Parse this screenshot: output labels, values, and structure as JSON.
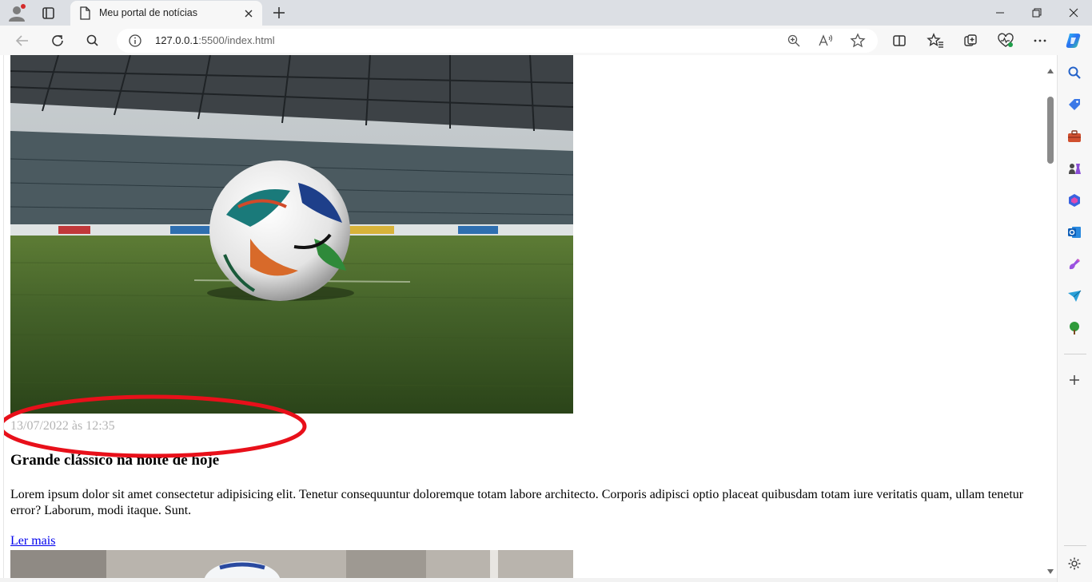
{
  "browser": {
    "tab_title": "Meu portal de notícias",
    "url_host": "127.0.0.1",
    "url_rest": ":5500/index.html",
    "icons": {
      "profile": "profile-avatar-icon",
      "tab_actions": "tab-actions-icon",
      "page": "page-icon",
      "close_tab": "close-icon",
      "new_tab": "plus-icon",
      "back": "arrow-left-icon",
      "refresh": "refresh-icon",
      "search": "search-icon",
      "site_info": "info-icon",
      "zoom": "zoom-in-icon",
      "read_aloud": "read-aloud-icon",
      "favorite": "star-icon",
      "split_screen": "split-screen-icon",
      "favorites": "favorites-icon",
      "collections": "collections-icon",
      "browser_essentials": "heart-pulse-icon",
      "more": "more-icon",
      "copilot": "copilot-icon"
    }
  },
  "sidebar": {
    "items": [
      "search-icon",
      "tag-icon",
      "toolbox-icon",
      "chess-icon",
      "microsoft365-icon",
      "outlook-icon",
      "designer-icon",
      "send-icon",
      "tree-icon",
      "plus-icon",
      "gear-icon"
    ]
  },
  "article": {
    "date": "13/07/2022 às 12:35",
    "headline": "Grande clássico na noite de hoje",
    "body": "Lorem ipsum dolor sit amet consectetur adipisicing elit. Tenetur consequuntur doloremque totam labore architecto. Corporis adipisci optio placeat quibusdam totam iure veritatis quam, ullam tenetur error? Laborum, modi itaque. Sunt.",
    "read_more": "Ler mais"
  },
  "colors": {
    "annotation": "#e8101a",
    "link": "#0000ee",
    "date_text": "#b3b3b3"
  }
}
